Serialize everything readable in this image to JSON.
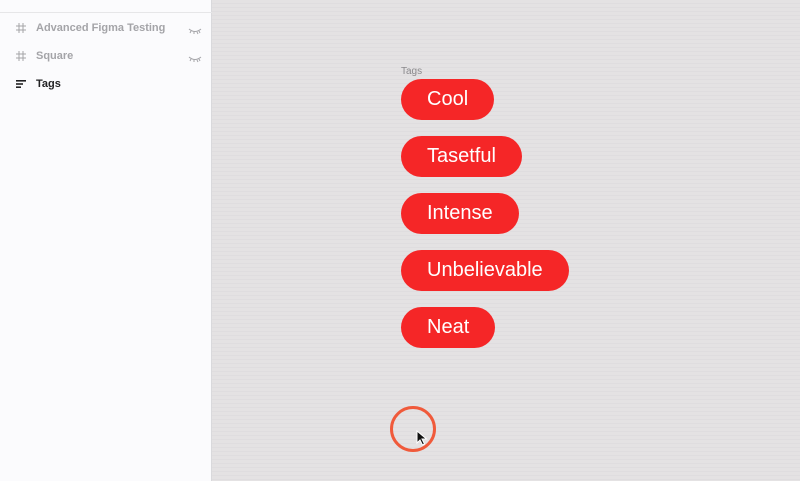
{
  "layers": {
    "items": [
      {
        "label": "Advanced Figma Testing",
        "icon": "frame-icon",
        "visibility_icon": "eye-closed-icon"
      },
      {
        "label": "Square",
        "icon": "frame-icon",
        "visibility_icon": "eye-closed-icon"
      },
      {
        "label": "Tags",
        "icon": "auto-layout-icon"
      }
    ]
  },
  "canvas": {
    "frame_label": "Tags",
    "tags": [
      "Cool",
      "Tasetful",
      "Intense",
      "Unbelievable",
      "Neat"
    ]
  },
  "colors": {
    "tag_fill": "#f52627",
    "tag_text": "#ffffff",
    "click_ring": "#f05a3b",
    "canvas_bg": "#e4e2e3",
    "sidebar_bg": "#fbfbfd"
  }
}
